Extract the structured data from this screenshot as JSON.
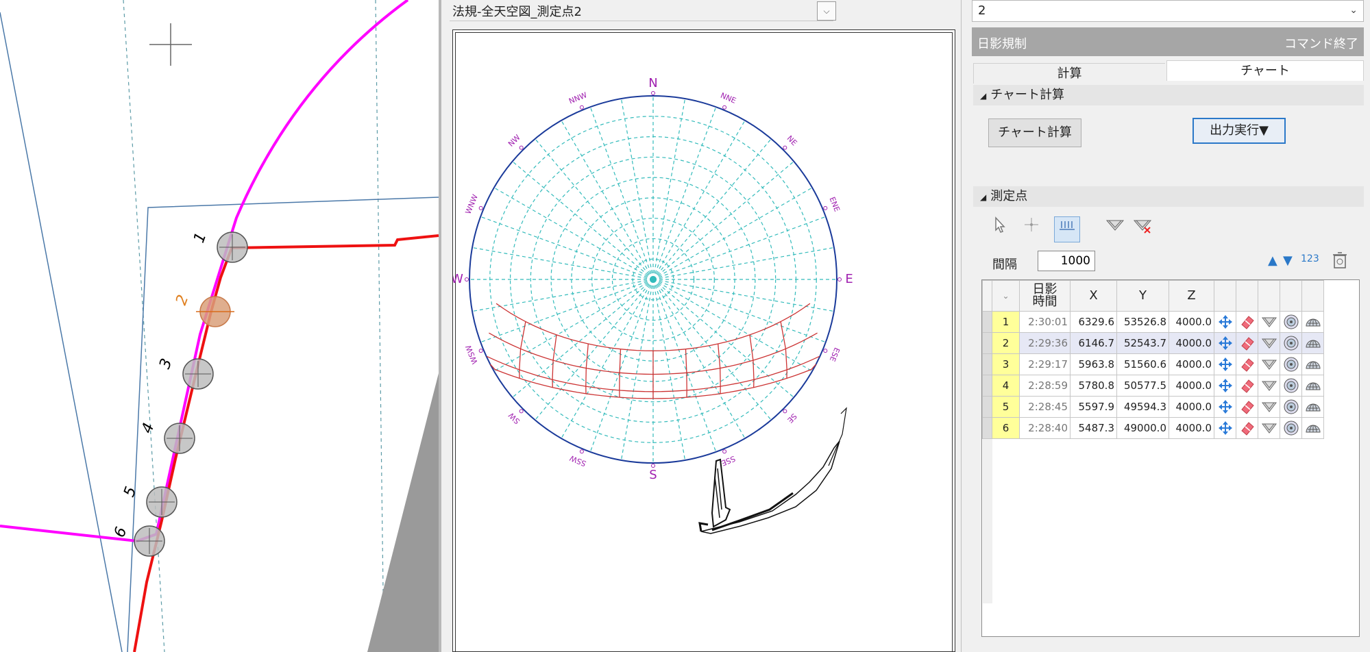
{
  "cad": {
    "point_labels": [
      "1",
      "2",
      "3",
      "4",
      "5",
      "6"
    ]
  },
  "chart_panel": {
    "selector_value": "法規-全天空図_測定点2",
    "directions": [
      "N",
      "NNE",
      "NE",
      "ENE",
      "E",
      "ESE",
      "SE",
      "SSE",
      "S",
      "SSW",
      "SW",
      "WSW",
      "W",
      "WNW",
      "NW",
      "NNW"
    ]
  },
  "right_panel": {
    "top_select_value": "2",
    "title": "日影規制",
    "close_command": "コマンド終了",
    "tabs": {
      "calc": "計算",
      "chart": "チャート"
    },
    "chart_section": "チャート計算",
    "chart_calc_button": "チャート計算",
    "output_button": "出力実行▼",
    "points_section": "測定点",
    "interval_label": "間隔",
    "interval_value": "1000",
    "order_label": "123"
  },
  "table": {
    "headers": [
      "",
      "日影\n時間",
      "X",
      "Y",
      "Z"
    ],
    "header_time_l1": "日影",
    "header_time_l2": "時間",
    "rows": [
      {
        "no": "1",
        "time": "2:30:01",
        "x": "6329.6",
        "y": "53526.8",
        "z": "4000.0"
      },
      {
        "no": "2",
        "time": "2:29:36",
        "x": "6146.7",
        "y": "52543.7",
        "z": "4000.0"
      },
      {
        "no": "3",
        "time": "2:29:17",
        "x": "5963.8",
        "y": "51560.6",
        "z": "4000.0"
      },
      {
        "no": "4",
        "time": "2:28:59",
        "x": "5780.8",
        "y": "50577.5",
        "z": "4000.0"
      },
      {
        "no": "5",
        "time": "2:28:45",
        "x": "5597.9",
        "y": "49594.3",
        "z": "4000.0"
      },
      {
        "no": "6",
        "time": "2:28:40",
        "x": "5487.3",
        "y": "49000.0",
        "z": "4000.0"
      }
    ]
  },
  "colors": {
    "magenta_line": "#ff00ff",
    "red_line": "#ee1111",
    "chart_grid": "#33bbbb",
    "sun_path": "#cc3333",
    "title_bar": "#a6a6a6",
    "row_number_bg": "#ffff9a"
  }
}
